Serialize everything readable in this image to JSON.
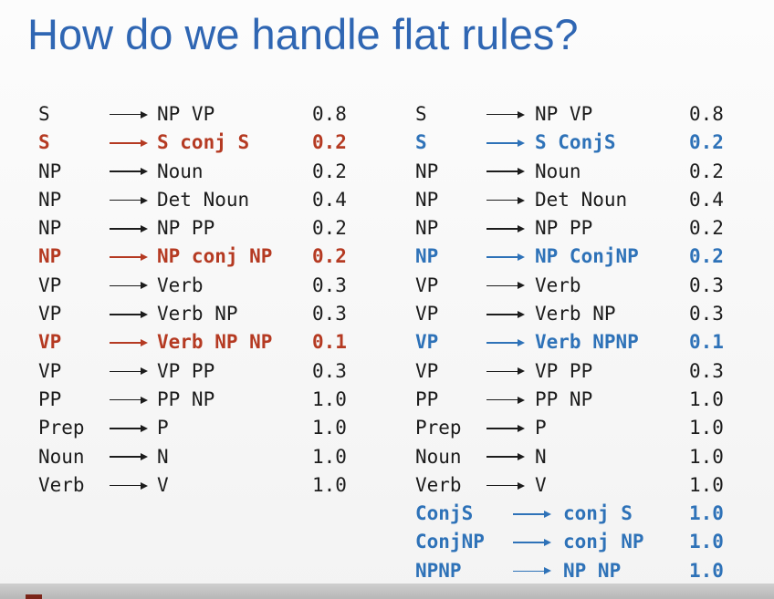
{
  "title": "How do we handle flat rules?",
  "colors": {
    "title": "#2f66b3",
    "highlight_left": "#b53a22",
    "highlight_right": "#2e72b8"
  },
  "left_grammar": [
    {
      "lhs": "S",
      "rhs": "NP VP",
      "prob": "0.8",
      "style": "normal"
    },
    {
      "lhs": "S",
      "rhs": "S conj S",
      "prob": "0.2",
      "style": "red"
    },
    {
      "lhs": "NP",
      "rhs": "Noun",
      "prob": "0.2",
      "style": "normal"
    },
    {
      "lhs": "NP",
      "rhs": "Det Noun",
      "prob": "0.4",
      "style": "normal"
    },
    {
      "lhs": "NP",
      "rhs": "NP PP",
      "prob": "0.2",
      "style": "normal"
    },
    {
      "lhs": "NP",
      "rhs": "NP conj NP",
      "prob": "0.2",
      "style": "red"
    },
    {
      "lhs": "VP",
      "rhs": "Verb",
      "prob": "0.3",
      "style": "normal"
    },
    {
      "lhs": "VP",
      "rhs": "Verb NP",
      "prob": "0.3",
      "style": "normal"
    },
    {
      "lhs": "VP",
      "rhs": "Verb NP NP",
      "prob": "0.1",
      "style": "red"
    },
    {
      "lhs": "VP",
      "rhs": "VP PP",
      "prob": "0.3",
      "style": "normal"
    },
    {
      "lhs": "PP",
      "rhs": "PP NP",
      "prob": "1.0",
      "style": "normal"
    },
    {
      "lhs": "Prep",
      "rhs": "P",
      "prob": "1.0",
      "style": "normal"
    },
    {
      "lhs": "Noun",
      "rhs": "N",
      "prob": "1.0",
      "style": "normal"
    },
    {
      "lhs": "Verb",
      "rhs": "V",
      "prob": "1.0",
      "style": "normal"
    }
  ],
  "right_grammar": [
    {
      "lhs": "S",
      "rhs": "NP VP",
      "prob": "0.8",
      "style": "normal"
    },
    {
      "lhs": "S",
      "rhs": "S ConjS",
      "prob": "0.2",
      "style": "blue"
    },
    {
      "lhs": "NP",
      "rhs": "Noun",
      "prob": "0.2",
      "style": "normal"
    },
    {
      "lhs": "NP",
      "rhs": "Det Noun",
      "prob": "0.4",
      "style": "normal"
    },
    {
      "lhs": "NP",
      "rhs": "NP PP",
      "prob": "0.2",
      "style": "normal"
    },
    {
      "lhs": "NP",
      "rhs": "NP ConjNP",
      "prob": "0.2",
      "style": "blue"
    },
    {
      "lhs": "VP",
      "rhs": "Verb",
      "prob": "0.3",
      "style": "normal"
    },
    {
      "lhs": "VP",
      "rhs": "Verb NP",
      "prob": "0.3",
      "style": "normal"
    },
    {
      "lhs": "VP",
      "rhs": "Verb NPNP",
      "prob": "0.1",
      "style": "blue"
    },
    {
      "lhs": "VP",
      "rhs": "VP PP",
      "prob": "0.3",
      "style": "normal"
    },
    {
      "lhs": "PP",
      "rhs": "PP NP",
      "prob": "1.0",
      "style": "normal"
    },
    {
      "lhs": "Prep",
      "rhs": "P",
      "prob": "1.0",
      "style": "normal"
    },
    {
      "lhs": "Noun",
      "rhs": "N",
      "prob": "1.0",
      "style": "normal"
    },
    {
      "lhs": "Verb",
      "rhs": "V",
      "prob": "1.0",
      "style": "normal"
    },
    {
      "lhs": "ConjS",
      "rhs": "conj S",
      "prob": "1.0",
      "style": "blue",
      "wide": true
    },
    {
      "lhs": "ConjNP",
      "rhs": "conj NP",
      "prob": "1.0",
      "style": "blue",
      "wide": true
    },
    {
      "lhs": "NPNP",
      "rhs": "NP NP",
      "prob": "1.0",
      "style": "blue",
      "wide": true
    }
  ]
}
